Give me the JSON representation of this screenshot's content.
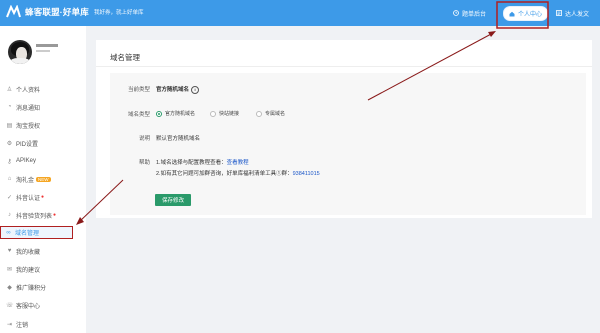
{
  "header": {
    "brand_name": "蜂客联盟·好单库",
    "slogan": "我好券，就上好单库",
    "backend_label": "题单后台",
    "personal_center_label": "个人中心",
    "publish_label": "达人发文"
  },
  "sidebar": {
    "items": [
      {
        "label": "个人资料",
        "icon": "user-icon"
      },
      {
        "label": "消息通知",
        "icon": "bell-icon"
      },
      {
        "label": "淘宝授权",
        "icon": "doc-icon"
      },
      {
        "label": "PID设置",
        "icon": "gear-icon"
      },
      {
        "label": "APIKey",
        "icon": "key-icon"
      },
      {
        "label": "淘礼金",
        "icon": "gift-icon",
        "badge": "NEW"
      },
      {
        "label": "抖音认证",
        "icon": "check-icon"
      },
      {
        "label": "抖音验货列表",
        "icon": "music-icon"
      },
      {
        "label": "域名管理",
        "icon": "link-icon",
        "active": true
      },
      {
        "label": "我的收藏",
        "icon": "heart-icon"
      },
      {
        "label": "我的建议",
        "icon": "comment-icon"
      },
      {
        "label": "推广赚积分",
        "icon": "coin-icon"
      },
      {
        "label": "客服中心",
        "icon": "headset-icon"
      },
      {
        "label": "注销",
        "icon": "logout-icon"
      }
    ]
  },
  "main": {
    "title": "域名管理",
    "current_type_label": "当前类型",
    "current_type_value": "官方随机域名",
    "domain_type_label": "域名类型",
    "options": [
      "官方随机域名",
      "快站链接",
      "专属域名"
    ],
    "description_label": "说明",
    "description_value": "默认官方随机域名",
    "help_label": "帮助",
    "help_line1_prefix": "1.域名选择与配置教程查看：",
    "help_line1_link": "查看教程",
    "help_line2_prefix": "2.如有其它问题可加群咨询，好单库福利清单工具①群：",
    "help_line2_link": "938411015",
    "save_label": "保存修改"
  },
  "colors": {
    "brand": "#3d9ae8",
    "accent": "#2a9a6a",
    "highlight": "#b02020"
  }
}
